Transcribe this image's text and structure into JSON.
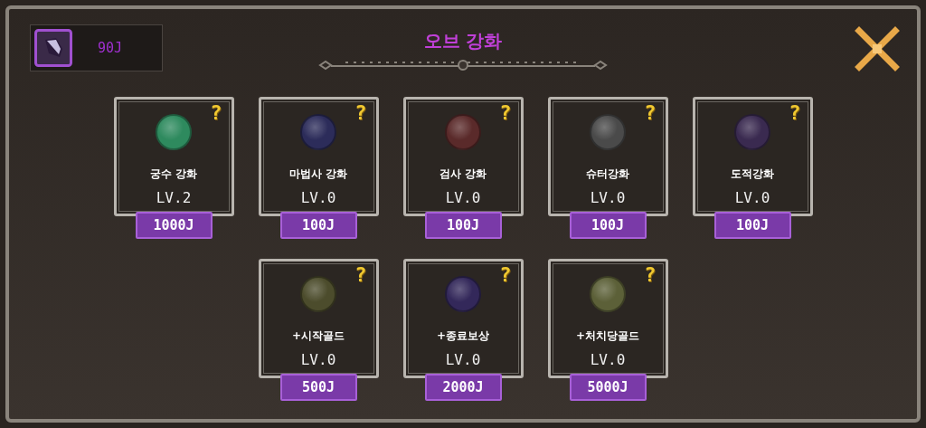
{
  "currency": {
    "amount": "90J"
  },
  "title": "오브 강화",
  "rows": [
    [
      {
        "name": "궁수 강화",
        "level": "LV.2",
        "price": "1000J",
        "color": "#2e8a5e",
        "help": "?"
      },
      {
        "name": "마법사 강화",
        "level": "LV.0",
        "price": "100J",
        "color": "#2c2c5a",
        "help": "?"
      },
      {
        "name": "검사 강화",
        "level": "LV.0",
        "price": "100J",
        "color": "#5a2a2a",
        "help": "?"
      },
      {
        "name": "슈터강화",
        "level": "LV.0",
        "price": "100J",
        "color": "#4a4a4a",
        "help": "?"
      },
      {
        "name": "도적강화",
        "level": "LV.0",
        "price": "100J",
        "color": "#3a2a50",
        "help": "?"
      }
    ],
    [
      {
        "name": "+시작골드",
        "level": "LV.0",
        "price": "500J",
        "color": "#4c4c2c",
        "help": "?"
      },
      {
        "name": "+종료보상",
        "level": "LV.0",
        "price": "2000J",
        "color": "#33285a",
        "help": "?"
      },
      {
        "name": "+처치당골드",
        "level": "LV.0",
        "price": "5000J",
        "color": "#5c6038",
        "help": "?"
      }
    ]
  ]
}
